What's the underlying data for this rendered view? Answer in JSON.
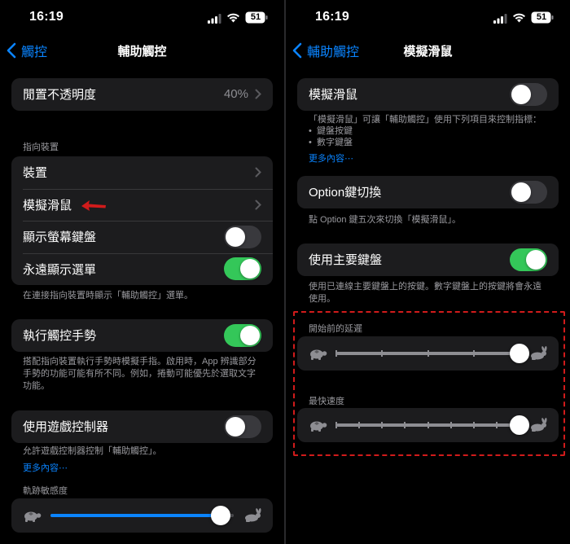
{
  "left": {
    "status": {
      "time": "16:19",
      "battery": "51"
    },
    "nav": {
      "back_label": "觸控",
      "title": "輔助觸控"
    },
    "idle_opacity": {
      "label": "閒置不透明度",
      "value": "40%"
    },
    "pointer_section": {
      "header": "指向裝置"
    },
    "pointer_rows": [
      {
        "label": "裝置"
      },
      {
        "label": "模擬滑鼠"
      },
      {
        "label": "顯示螢幕鍵盤",
        "toggle": false
      },
      {
        "label": "永遠顯示選單",
        "toggle": true
      }
    ],
    "pointer_caption": "在連接指向裝置時顯示「輔助觸控」選單。",
    "gestures": {
      "label": "執行觸控手勢",
      "toggle": true,
      "caption": "搭配指向裝置執行手勢時模擬手指。啟用時，App 辨識部分手勢的功能可能有所不同。例如，捲動可能優先於選取文字功能。"
    },
    "game_controller": {
      "label": "使用遊戲控制器",
      "toggle": false,
      "caption": "允許遊戲控制器控制「輔助觸控」。",
      "more": "更多內容⋯"
    },
    "tracking": {
      "header": "軌跡敏感度",
      "value": 0.93
    }
  },
  "right": {
    "status": {
      "time": "16:19",
      "battery": "51"
    },
    "nav": {
      "back_label": "輔助觸控",
      "title": "模擬滑鼠"
    },
    "mouse_keys": {
      "label": "模擬滑鼠",
      "toggle": false,
      "caption": "「模擬滑鼠」可讓「輔助觸控」使用下列項目來控制指標：",
      "bullets": [
        "鍵盤按鍵",
        "數字鍵盤"
      ],
      "more": "更多內容⋯"
    },
    "option_toggle": {
      "label": "Option鍵切換",
      "toggle": false,
      "caption": "點 Option 鍵五次來切換「模擬滑鼠」。"
    },
    "main_keyboard": {
      "label": "使用主要鍵盤",
      "toggle": true,
      "caption": "使用已連線主要鍵盤上的按鍵。數字鍵盤上的按鍵將會永遠使用。"
    },
    "initial_delay": {
      "header": "開始前的延遲",
      "value": 1.0,
      "steps": 5
    },
    "max_speed": {
      "header": "最快速度",
      "value": 1.0,
      "steps": 9
    }
  },
  "colors": {
    "accent": "#0a84ff",
    "toggle_on": "#34c759",
    "annotation": "#d11b1b"
  },
  "icons": [
    "signal-icon",
    "wifi-icon",
    "battery-icon",
    "back-chevron-icon",
    "chevron-right-icon",
    "turtle-icon",
    "rabbit-icon",
    "red-arrow-icon"
  ]
}
